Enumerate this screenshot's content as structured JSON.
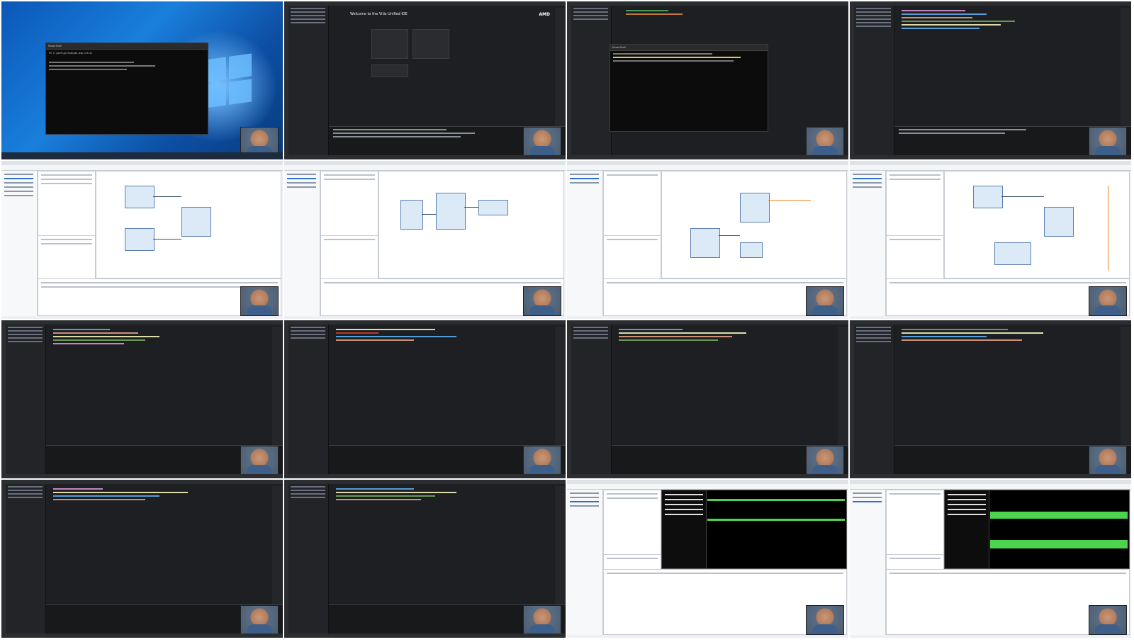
{
  "screenshot": {
    "layout": "4x4 contact sheet of screen-recording frames",
    "frames": [
      {
        "id": "f1",
        "kind": "desktop",
        "terminal_title": "PowerShell",
        "terminal_line": "PS C:\\work\\github\\adv-bsp-vitis>"
      },
      {
        "id": "f2",
        "kind": "ide-welcome",
        "title": "Welcome to the Vitis Unified IDE",
        "brand": "AMD"
      },
      {
        "id": "f3",
        "kind": "ide-terminal",
        "terminal_title": "PowerShell"
      },
      {
        "id": "f4",
        "kind": "ide-code"
      },
      {
        "id": "f5",
        "kind": "vivado-block"
      },
      {
        "id": "f6",
        "kind": "vivado-block"
      },
      {
        "id": "f7",
        "kind": "vivado-block"
      },
      {
        "id": "f8",
        "kind": "vivado-block"
      },
      {
        "id": "f9",
        "kind": "ide-code"
      },
      {
        "id": "f10",
        "kind": "ide-code"
      },
      {
        "id": "f11",
        "kind": "ide-code"
      },
      {
        "id": "f12",
        "kind": "ide-code"
      },
      {
        "id": "f13",
        "kind": "ide-code"
      },
      {
        "id": "f14",
        "kind": "ide-code"
      },
      {
        "id": "f15",
        "kind": "vivado-waveform"
      },
      {
        "id": "f16",
        "kind": "vivado-waveform"
      }
    ]
  },
  "colors": {
    "ide_bg": "#1e1f22",
    "vivado_bg": "#eef0f3",
    "desktop_blue": "#0a57b8",
    "accent": "#2e6fd1",
    "wave_green": "#4cd44c"
  }
}
